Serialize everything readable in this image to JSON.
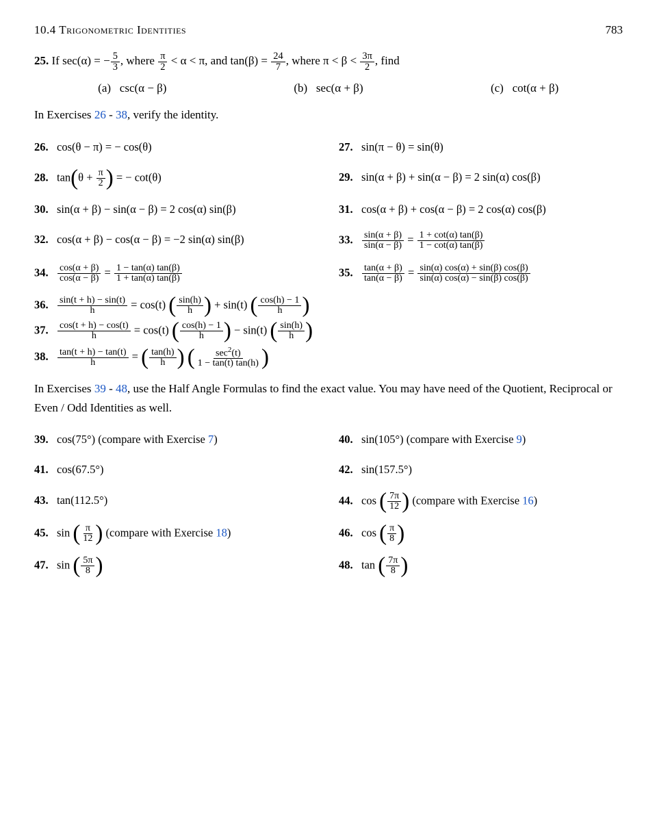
{
  "header": {
    "chapter": "10.4 Trigonometric Identities",
    "page": "783"
  },
  "problem25": {
    "label": "25.",
    "text": "If sec(α) = −",
    "frac_num": "5",
    "frac_den": "3",
    "text2": ", where",
    "text3": "π",
    "text3b": "2",
    "text4": "< α < π, and tan(β) =",
    "frac2_num": "24",
    "frac2_den": "7",
    "text5": ", where π < β <",
    "frac3_num": "3π",
    "frac3_den": "2",
    "text6": ", find",
    "parts": [
      "(a)  csc(α − β)",
      "(b)  sec(α + β)",
      "(c)  cot(α + β)"
    ]
  },
  "intro26_38": "In Exercises 26 - 38, verify the identity.",
  "exercises_26_38": [
    {
      "num": "26.",
      "expr": "cos(θ − π) = − cos(θ)",
      "col": "left"
    },
    {
      "num": "27.",
      "expr": "sin(π − θ) = sin(θ)",
      "col": "right"
    },
    {
      "num": "28.",
      "expr": "tan(θ + π/2) = − cot(θ)",
      "col": "left"
    },
    {
      "num": "29.",
      "expr": "sin(α + β) + sin(α − β) = 2 sin(α) cos(β)",
      "col": "right"
    },
    {
      "num": "30.",
      "expr": "sin(α + β) − sin(α − β) = 2 cos(α) sin(β)",
      "col": "left"
    },
    {
      "num": "31.",
      "expr": "cos(α + β) + cos(α − β) = 2 cos(α) cos(β)",
      "col": "right"
    },
    {
      "num": "32.",
      "expr": "cos(α + β) − cos(α − β) = −2 sin(α) sin(β)",
      "col": "left"
    },
    {
      "num": "33.",
      "expr": "sin(α+β)/sin(α−β) = (1+cot(α)tan(β))/(1−cot(α)tan(β))",
      "col": "right"
    },
    {
      "num": "34.",
      "expr": "cos(α+β)/cos(α−β) = (1−tan(α)tan(β))/(1+tan(α)tan(β))",
      "col": "left"
    },
    {
      "num": "35.",
      "expr": "tan(α+β)/tan(α−β) = (sin(α)cos(α)+sin(β)cos(β))/(sin(α)cos(α)−sin(β)cos(β))",
      "col": "right"
    },
    {
      "num": "36.",
      "expr": "(sin(t+h)−sin(t))/h = cos(t)(sin(h)/h) + sin(t)((cos(h)−1)/h)",
      "col": "full"
    },
    {
      "num": "37.",
      "expr": "(cos(t+h)−cos(t))/h = cos(t)((cos(h)−1)/h) − sin(t)(sin(h)/h)",
      "col": "full"
    },
    {
      "num": "38.",
      "expr": "(tan(t+h)−tan(t))/h = (tan(h)/h)(sec²(t)/(1−tan(t)tan(h)))",
      "col": "full"
    }
  ],
  "intro39_48": "In Exercises 39 - 48, use the Half Angle Formulas to find the exact value. You may have need of the Quotient, Reciprocal or Even / Odd Identities as well.",
  "exercises_39_48": [
    {
      "num": "39.",
      "expr": "cos(75°) (compare with Exercise 7)",
      "col": "left"
    },
    {
      "num": "40.",
      "expr": "sin(105°) (compare with Exercise 9)",
      "col": "right"
    },
    {
      "num": "41.",
      "expr": "cos(67.5°)",
      "col": "left"
    },
    {
      "num": "42.",
      "expr": "sin(157.5°)",
      "col": "right"
    },
    {
      "num": "43.",
      "expr": "tan(112.5°)",
      "col": "left"
    },
    {
      "num": "44.",
      "expr": "cos(7π/12) (compare with Exercise 16)",
      "col": "right"
    },
    {
      "num": "45.",
      "expr": "sin(π/12) (compare with Exercise 18)",
      "col": "left"
    },
    {
      "num": "46.",
      "expr": "cos(π/8)",
      "col": "right"
    },
    {
      "num": "47.",
      "expr": "sin(5π/8)",
      "col": "left"
    },
    {
      "num": "48.",
      "expr": "tan(7π/8)",
      "col": "right"
    }
  ]
}
